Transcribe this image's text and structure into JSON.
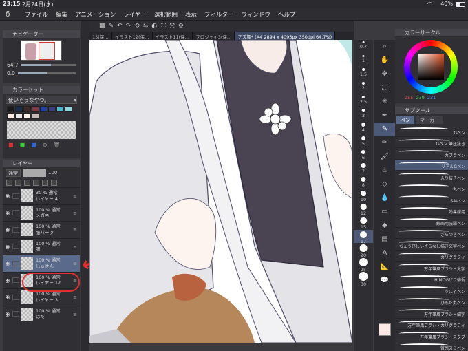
{
  "status": {
    "time": "23:15",
    "date": "2月24日(水)",
    "battery": "40%",
    "battery_level": 0.4
  },
  "menu": {
    "items": [
      "ファイル",
      "編集",
      "アニメーション",
      "レイヤー",
      "選択範囲",
      "表示",
      "フィルター",
      "ウィンドウ",
      "ヘルプ"
    ]
  },
  "navigator": {
    "title": "ナビゲーター",
    "zoom": "64.7",
    "angle": "0.0",
    "zoom_level": 0.55,
    "angle_level": 0.5
  },
  "colorset": {
    "title": "カラーセット",
    "selected": "使いそうなやつ。",
    "swatches": [
      "#1a1a1a",
      "#1c2f4a",
      "#3a2a2a",
      "#7a3a46",
      "#2440a0",
      "#3b3b80",
      "#4fb8c6",
      "#8fd7de",
      "#fbe9e4",
      "#e9e9e9",
      "#fff3f0",
      "#c7b9b3"
    ]
  },
  "layers": {
    "title": "レイヤー",
    "blend": "通常",
    "opacity": "100",
    "opacity_level": 1.0,
    "items": [
      {
        "opacity": "30 % 通常",
        "name": "レイヤー 4"
      },
      {
        "opacity": "100 % 通常",
        "name": "メガネ"
      },
      {
        "opacity": "100 % 通常",
        "name": "服パーツ"
      },
      {
        "opacity": "100 % 通常",
        "name": "服"
      },
      {
        "opacity": "100 % 通常",
        "name": "しゅせん"
      },
      {
        "opacity": "100 % 通常",
        "name": "レイヤー 12"
      },
      {
        "opacity": "100 % 通常",
        "name": "レイヤー 3"
      },
      {
        "opacity": "100 % 通常",
        "name": "はだ"
      }
    ]
  },
  "annotation": {
    "text": "←!?"
  },
  "tabs": [
    "15(保…",
    "イラスト12(保…",
    "イラスト11(保…",
    "フロジェイ3(保…",
    "アズ調* (A4 2894 x 4093px 350dpi 64.7%)"
  ],
  "brush_sizes": [
    "0.7",
    "1",
    "1.5",
    "2",
    "2.5",
    "3",
    "4",
    "5",
    "6",
    "7",
    "8",
    "10",
    "12",
    "15",
    "17",
    "20",
    "25",
    "30"
  ],
  "color_wheel": {
    "title": "カラーサークル",
    "r": "255",
    "g": "239",
    "b": "231",
    "current": "#fbeae5"
  },
  "subtool": {
    "title": "サブツール",
    "tab_pen": "ペン",
    "tab_marker": "マーカー",
    "brushes": [
      "Gペン",
      "Gペン 筆圧抜き",
      "カブラペン",
      "リアルGペン",
      "入り抜きペン",
      "丸ペン",
      "SAIペン",
      "効果線用",
      "線画用強弱ペン",
      "ざらつきペン",
      "ちょうびしいざらなし描き文字ペン",
      "カリグラフィ",
      "万年筆風ブラシ・太字",
      "HIMOGザラ強弱",
      "うにゃペン",
      "ひもだ丸ペン",
      "万年筆風ブラシ・細字",
      "万年筆風ブラシ・カリグラフィ",
      "万年筆風ブラシ・スタブ",
      "質感スミペン"
    ]
  }
}
